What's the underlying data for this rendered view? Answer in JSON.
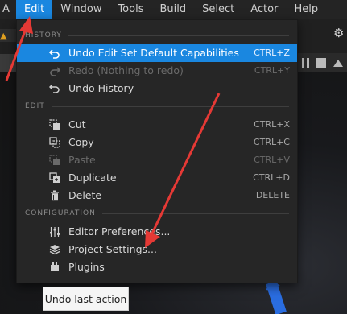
{
  "menubar": {
    "items": [
      {
        "label": "A"
      },
      {
        "label": "Edit"
      },
      {
        "label": "Window"
      },
      {
        "label": "Tools"
      },
      {
        "label": "Build"
      },
      {
        "label": "Select"
      },
      {
        "label": "Actor"
      },
      {
        "label": "Help"
      }
    ],
    "active_index": 1
  },
  "editor": {
    "left_tab_label": "ersp"
  },
  "edit_menu": {
    "sections": {
      "history": "HISTORY",
      "edit": "EDIT",
      "configuration": "CONFIGURATION"
    },
    "history_items": [
      {
        "label": "Undo Edit Set Default Capabilities",
        "shortcut": "CTRL+Z",
        "icon": "undo-icon",
        "highlighted": true,
        "enabled": true
      },
      {
        "label": "Redo (Nothing to redo)",
        "shortcut": "CTRL+Y",
        "icon": "redo-icon",
        "highlighted": false,
        "enabled": false
      },
      {
        "label": "Undo History",
        "shortcut": "",
        "icon": "history-icon",
        "highlighted": false,
        "enabled": true
      }
    ],
    "edit_items": [
      {
        "label": "Cut",
        "shortcut": "CTRL+X",
        "icon": "cut-icon",
        "enabled": true
      },
      {
        "label": "Copy",
        "shortcut": "CTRL+C",
        "icon": "copy-icon",
        "enabled": true
      },
      {
        "label": "Paste",
        "shortcut": "CTRL+V",
        "icon": "paste-icon",
        "enabled": false
      },
      {
        "label": "Duplicate",
        "shortcut": "CTRL+D",
        "icon": "duplicate-icon",
        "enabled": true
      },
      {
        "label": "Delete",
        "shortcut": "DELETE",
        "icon": "trash-icon",
        "enabled": true
      }
    ],
    "configuration_items": [
      {
        "label": "Editor Preferences...",
        "shortcut": "",
        "icon": "sliders-icon",
        "enabled": true
      },
      {
        "label": "Project Settings...",
        "shortcut": "",
        "icon": "project-settings-icon",
        "enabled": true
      },
      {
        "label": "Plugins",
        "shortcut": "",
        "icon": "plugin-icon",
        "enabled": true
      }
    ]
  },
  "tooltip": {
    "text": "Undo last action"
  },
  "colors": {
    "accent": "#1a87e0",
    "annotation_arrow": "#e53935",
    "menu_background": "#262626"
  }
}
